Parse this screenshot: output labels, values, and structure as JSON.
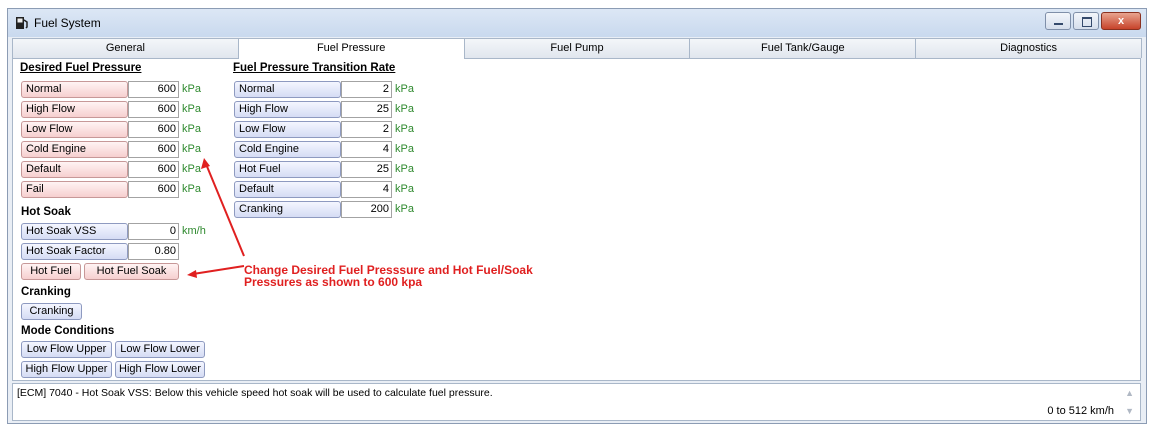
{
  "window": {
    "title": "Fuel System",
    "close_glyph": "x"
  },
  "tabs": [
    {
      "label": "General",
      "active": false
    },
    {
      "label": "Fuel Pressure",
      "active": true
    },
    {
      "label": "Fuel Pump",
      "active": false
    },
    {
      "label": "Fuel Tank/Gauge",
      "active": false
    },
    {
      "label": "Diagnostics",
      "active": false
    }
  ],
  "desired": {
    "title": "Desired Fuel Pressure",
    "rows": [
      {
        "label": "Normal",
        "value": "600",
        "unit": "kPa"
      },
      {
        "label": "High Flow",
        "value": "600",
        "unit": "kPa"
      },
      {
        "label": "Low Flow",
        "value": "600",
        "unit": "kPa"
      },
      {
        "label": "Cold Engine",
        "value": "600",
        "unit": "kPa"
      },
      {
        "label": "Default",
        "value": "600",
        "unit": "kPa"
      },
      {
        "label": "Fail",
        "value": "600",
        "unit": "kPa"
      }
    ]
  },
  "transition": {
    "title": "Fuel Pressure Transition Rate",
    "rows": [
      {
        "label": "Normal",
        "value": "2",
        "unit": "kPa"
      },
      {
        "label": "High Flow",
        "value": "25",
        "unit": "kPa"
      },
      {
        "label": "Low Flow",
        "value": "2",
        "unit": "kPa"
      },
      {
        "label": "Cold Engine",
        "value": "4",
        "unit": "kPa"
      },
      {
        "label": "Hot Fuel",
        "value": "25",
        "unit": "kPa"
      },
      {
        "label": "Default",
        "value": "4",
        "unit": "kPa"
      },
      {
        "label": "Cranking",
        "value": "200",
        "unit": "kPa"
      }
    ]
  },
  "hot_soak": {
    "title": "Hot Soak",
    "vss": {
      "label": "Hot Soak VSS",
      "value": "0",
      "unit": "km/h"
    },
    "factor": {
      "label": "Hot Soak Factor",
      "value": "0.80"
    },
    "buttons": [
      "Hot Fuel",
      "Hot Fuel Soak"
    ]
  },
  "cranking": {
    "title": "Cranking",
    "button": "Cranking"
  },
  "mode_conditions": {
    "title": "Mode Conditions",
    "buttons": [
      "Low Flow Upper",
      "Low Flow Lower",
      "High Flow Upper",
      "High Flow Lower"
    ]
  },
  "annotation": {
    "line1": "Change Desired Fuel Presssure and Hot Fuel/Soak",
    "line2": "Pressures as shown to 600 kpa"
  },
  "status": {
    "message": "[ECM] 7040 - Hot Soak VSS: Below this vehicle speed hot soak will be used to calculate fuel pressure.",
    "range": "0 to 512 km/h"
  },
  "colors": {
    "annotation": "#e02020",
    "unit": "#2f8a2f"
  }
}
